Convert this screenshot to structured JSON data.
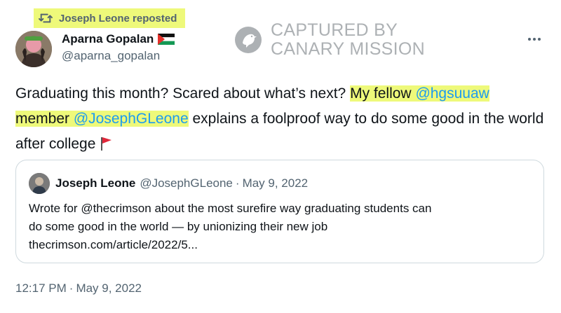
{
  "repost": {
    "text": "Joseph Leone reposted",
    "icon": "repost-icon"
  },
  "author": {
    "name": "Aparna Gopalan",
    "handle": "@aparna_gopalan",
    "flag_icon": "palestine-flag-icon"
  },
  "watermark": {
    "line1": "CAPTURED BY",
    "line2": "CANARY MISSION"
  },
  "tweet": {
    "part1": "Graduating this month? Scared about what’s next? ",
    "hl1": "My fellow ",
    "mention1": "@hgsuuaw",
    "hl2": "member ",
    "mention2": "@JosephGLeone",
    "part2": " explains a foolproof way to do some good in the world after college",
    "emoji": "red-flag-icon"
  },
  "quote": {
    "name": "Joseph Leone",
    "handle": "@JosephGLeone",
    "sep": "·",
    "date": "May 9, 2022",
    "line1": "Wrote for @thecrimson about the most surefire way graduating students can",
    "line2": "do some good in the world — by unionizing their new job",
    "line3": "thecrimson.com/article/2022/5..."
  },
  "timestamp": {
    "time": "12:17 PM",
    "sep": "·",
    "date": "May 9, 2022"
  },
  "colors": {
    "highlight": "#eef97a",
    "mention": "#1d9bf0",
    "secondary": "#536471",
    "border": "#cfd9de"
  }
}
